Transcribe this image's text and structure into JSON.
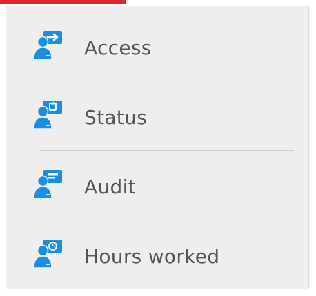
{
  "menu": {
    "items": [
      {
        "label": "Access",
        "icon": "user-access-arrow-icon"
      },
      {
        "label": "Status",
        "icon": "user-status-clipboard-icon"
      },
      {
        "label": "Audit",
        "icon": "user-audit-chat-icon"
      },
      {
        "label": "Hours worked",
        "icon": "user-hours-clock-icon"
      }
    ]
  },
  "colors": {
    "accent_red": "#e0262c",
    "icon_blue": "#1b8ee4",
    "menu_background": "#eeeeee",
    "label_text": "#555555",
    "divider": "#cfcfcf"
  }
}
